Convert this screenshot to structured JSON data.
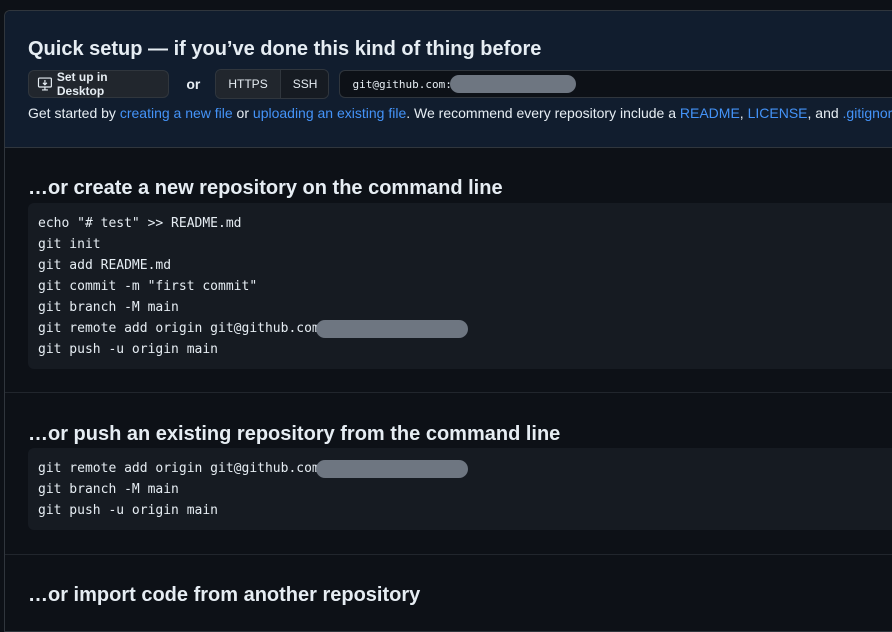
{
  "quick_setup": {
    "title": "Quick setup — if you’ve done this kind of thing before",
    "desktop_button": "Set up in Desktop",
    "or": "or",
    "protocols": [
      "HTTPS",
      "SSH"
    ],
    "active_protocol": "HTTPS",
    "clone_url_prefix": "git@github.com:",
    "hint": {
      "t1": "Get started by ",
      "link1": "creating a new file",
      "t2": " or ",
      "link2": "uploading an existing file",
      "t3": ". We recommend every repository include a ",
      "link3": "README",
      "t4": ", ",
      "link4": "LICENSE",
      "t5": ", and ",
      "link5": ".gitignore",
      "t6": "."
    }
  },
  "new_repo": {
    "title": "…or create a new repository on the command line",
    "lines": [
      "echo \"# test\" >> README.md",
      "git init",
      "git add README.md",
      "git commit -m \"first commit\"",
      "git branch -M main",
      "git remote add origin git@github.com",
      "git push -u origin main"
    ]
  },
  "push_existing": {
    "title": "…or push an existing repository from the command line",
    "lines": [
      "git remote add origin git@github.com:",
      "git branch -M main",
      "git push -u origin main"
    ]
  },
  "import": {
    "title": "…or import code from another repository"
  },
  "colors": {
    "link": "#4493f8",
    "quick_bg": "#111d2e",
    "page_bg": "#0d1117",
    "code_bg": "#161b22"
  }
}
